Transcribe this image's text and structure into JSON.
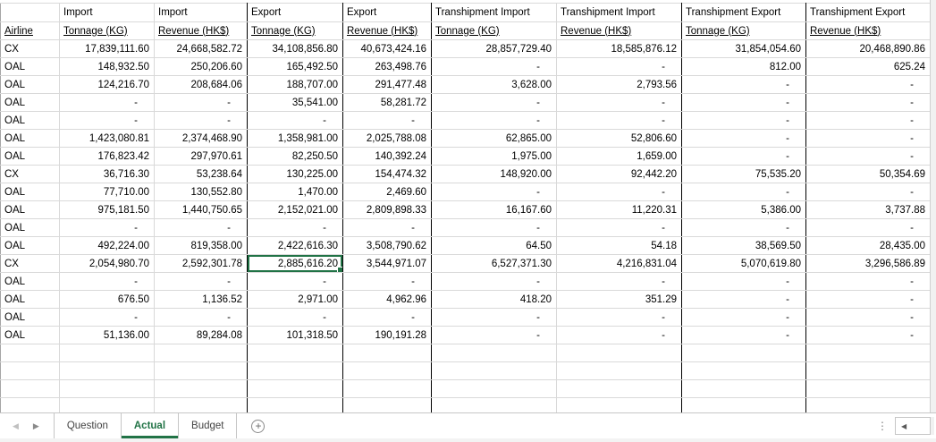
{
  "table": {
    "group_headers": [
      "",
      "Import",
      "Import",
      "Export",
      "Export",
      "Transhipment Import",
      "Transhipment Import",
      "Transhipment Export",
      "Transhipment Export"
    ],
    "column_headers": [
      "Airline",
      "Tonnage (KG)",
      "Revenue (HK$)",
      "Tonnage (KG)",
      "Revenue (HK$)",
      "Tonnage (KG)",
      "Revenue (HK$)",
      "Tonnage (KG)",
      "Revenue (HK$)"
    ],
    "rows": [
      [
        "CX",
        "17,839,111.60",
        "24,668,582.72",
        "34,108,856.80",
        "40,673,424.16",
        "28,857,729.40",
        "18,585,876.12",
        "31,854,054.60",
        "20,468,890.86"
      ],
      [
        "OAL",
        "148,932.50",
        "250,206.60",
        "165,492.50",
        "263,498.76",
        "-",
        "-",
        "812.00",
        "625.24"
      ],
      [
        "OAL",
        "124,216.70",
        "208,684.06",
        "188,707.00",
        "291,477.48",
        "3,628.00",
        "2,793.56",
        "-",
        "-"
      ],
      [
        "OAL",
        "-",
        "-",
        "35,541.00",
        "58,281.72",
        "-",
        "-",
        "-",
        "-"
      ],
      [
        "OAL",
        "-",
        "-",
        "-",
        "-",
        "-",
        "-",
        "-",
        "-"
      ],
      [
        "OAL",
        "1,423,080.81",
        "2,374,468.90",
        "1,358,981.00",
        "2,025,788.08",
        "62,865.00",
        "52,806.60",
        "-",
        "-"
      ],
      [
        "OAL",
        "176,823.42",
        "297,970.61",
        "82,250.50",
        "140,392.24",
        "1,975.00",
        "1,659.00",
        "-",
        "-"
      ],
      [
        "CX",
        "36,716.30",
        "53,238.64",
        "130,225.00",
        "154,474.32",
        "148,920.00",
        "92,442.20",
        "75,535.20",
        "50,354.69"
      ],
      [
        "OAL",
        "77,710.00",
        "130,552.80",
        "1,470.00",
        "2,469.60",
        "-",
        "-",
        "-",
        "-"
      ],
      [
        "OAL",
        "975,181.50",
        "1,440,750.65",
        "2,152,021.00",
        "2,809,898.33",
        "16,167.60",
        "11,220.31",
        "5,386.00",
        "3,737.88"
      ],
      [
        "OAL",
        "-",
        "-",
        "-",
        "-",
        "-",
        "-",
        "-",
        "-"
      ],
      [
        "OAL",
        "492,224.00",
        "819,358.00",
        "2,422,616.30",
        "3,508,790.62",
        "64.50",
        "54.18",
        "38,569.50",
        "28,435.00"
      ],
      [
        "CX",
        "2,054,980.70",
        "2,592,301.78",
        "2,885,616.20",
        "3,544,971.07",
        "6,527,371.30",
        "4,216,831.04",
        "5,070,619.80",
        "3,296,586.89"
      ],
      [
        "OAL",
        "-",
        "-",
        "-",
        "-",
        "-",
        "-",
        "-",
        "-"
      ],
      [
        "OAL",
        "676.50",
        "1,136.52",
        "2,971.00",
        "4,962.96",
        "418.20",
        "351.29",
        "-",
        "-"
      ],
      [
        "OAL",
        "-",
        "-",
        "-",
        "-",
        "-",
        "-",
        "-",
        "-"
      ],
      [
        "OAL",
        "51,136.00",
        "89,284.08",
        "101,318.50",
        "190,191.28",
        "-",
        "-",
        "-",
        "-"
      ]
    ],
    "selection": {
      "row": 12,
      "col": 3
    }
  },
  "sheet_bar": {
    "tabs": [
      {
        "label": "Question",
        "active": false
      },
      {
        "label": "Actual",
        "active": true
      },
      {
        "label": "Budget",
        "active": false
      }
    ],
    "icons": {
      "prev_sheet": "◀",
      "next_sheet": "▶",
      "add_sheet": "+",
      "splitter_dots": "⋮",
      "scroll_left": "◀"
    }
  },
  "colors": {
    "active_tab_green": "#217346",
    "selection_green": "#217346",
    "gridline": "#d9d9d9",
    "group_border": "#000000"
  }
}
